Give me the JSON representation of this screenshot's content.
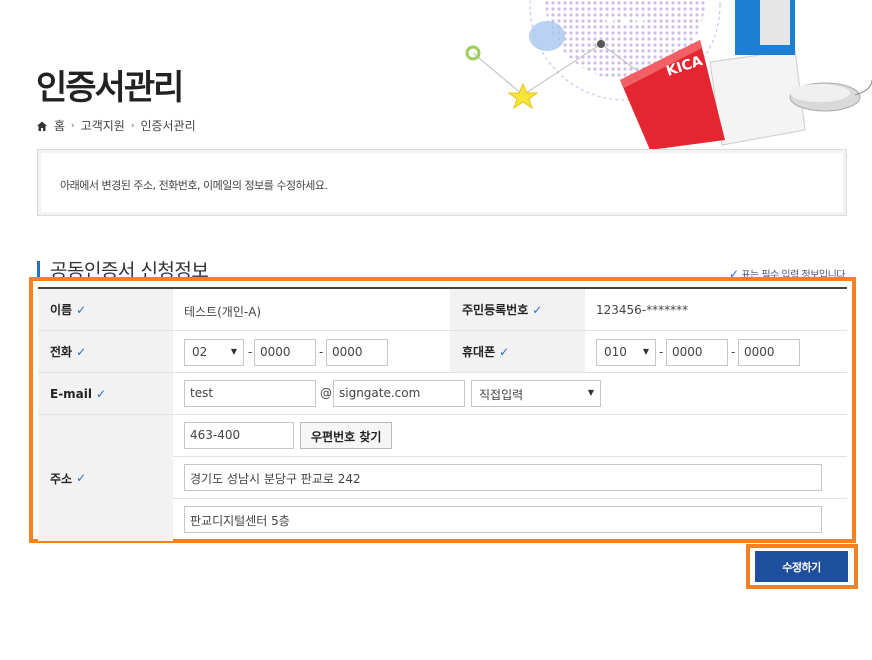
{
  "page": {
    "title": "인증서관리",
    "breadcrumb": [
      "홈",
      "고객지원",
      "인증서관리"
    ],
    "notice": "아래에서 변경된 주소, 전화번호, 이메일의 정보를 수정하세요.",
    "section_title": "공동인증서 신청정보",
    "required_note": "표는 필수 입력 정보입니다",
    "hero_badge": "KICA"
  },
  "form": {
    "name_label": "이름",
    "name_value": "테스트(개인-A)",
    "rrn_label": "주민등록번호",
    "rrn_value": "123456-*******",
    "phone_label": "전화",
    "phone_area": "02",
    "phone_mid": "0000",
    "phone_last": "0000",
    "mobile_label": "휴대폰",
    "mobile_prefix": "010",
    "mobile_mid": "0000",
    "mobile_last": "0000",
    "email_label": "E-mail",
    "email_id": "test",
    "email_at": "@",
    "email_domain": "signgate.com",
    "email_domain_select": "직접입력",
    "address_label": "주소",
    "zipcode": "463-400",
    "zipcode_button": "우편번호 찾기",
    "address1": "경기도 성남시 분당구 판교로 242",
    "address2": "판교디지털센터 5층",
    "dash": "-"
  },
  "actions": {
    "submit": "수정하기"
  },
  "colors": {
    "accent_orange": "#f58220",
    "primary_blue": "#1e4f9c",
    "check_blue": "#2d6cc0"
  }
}
